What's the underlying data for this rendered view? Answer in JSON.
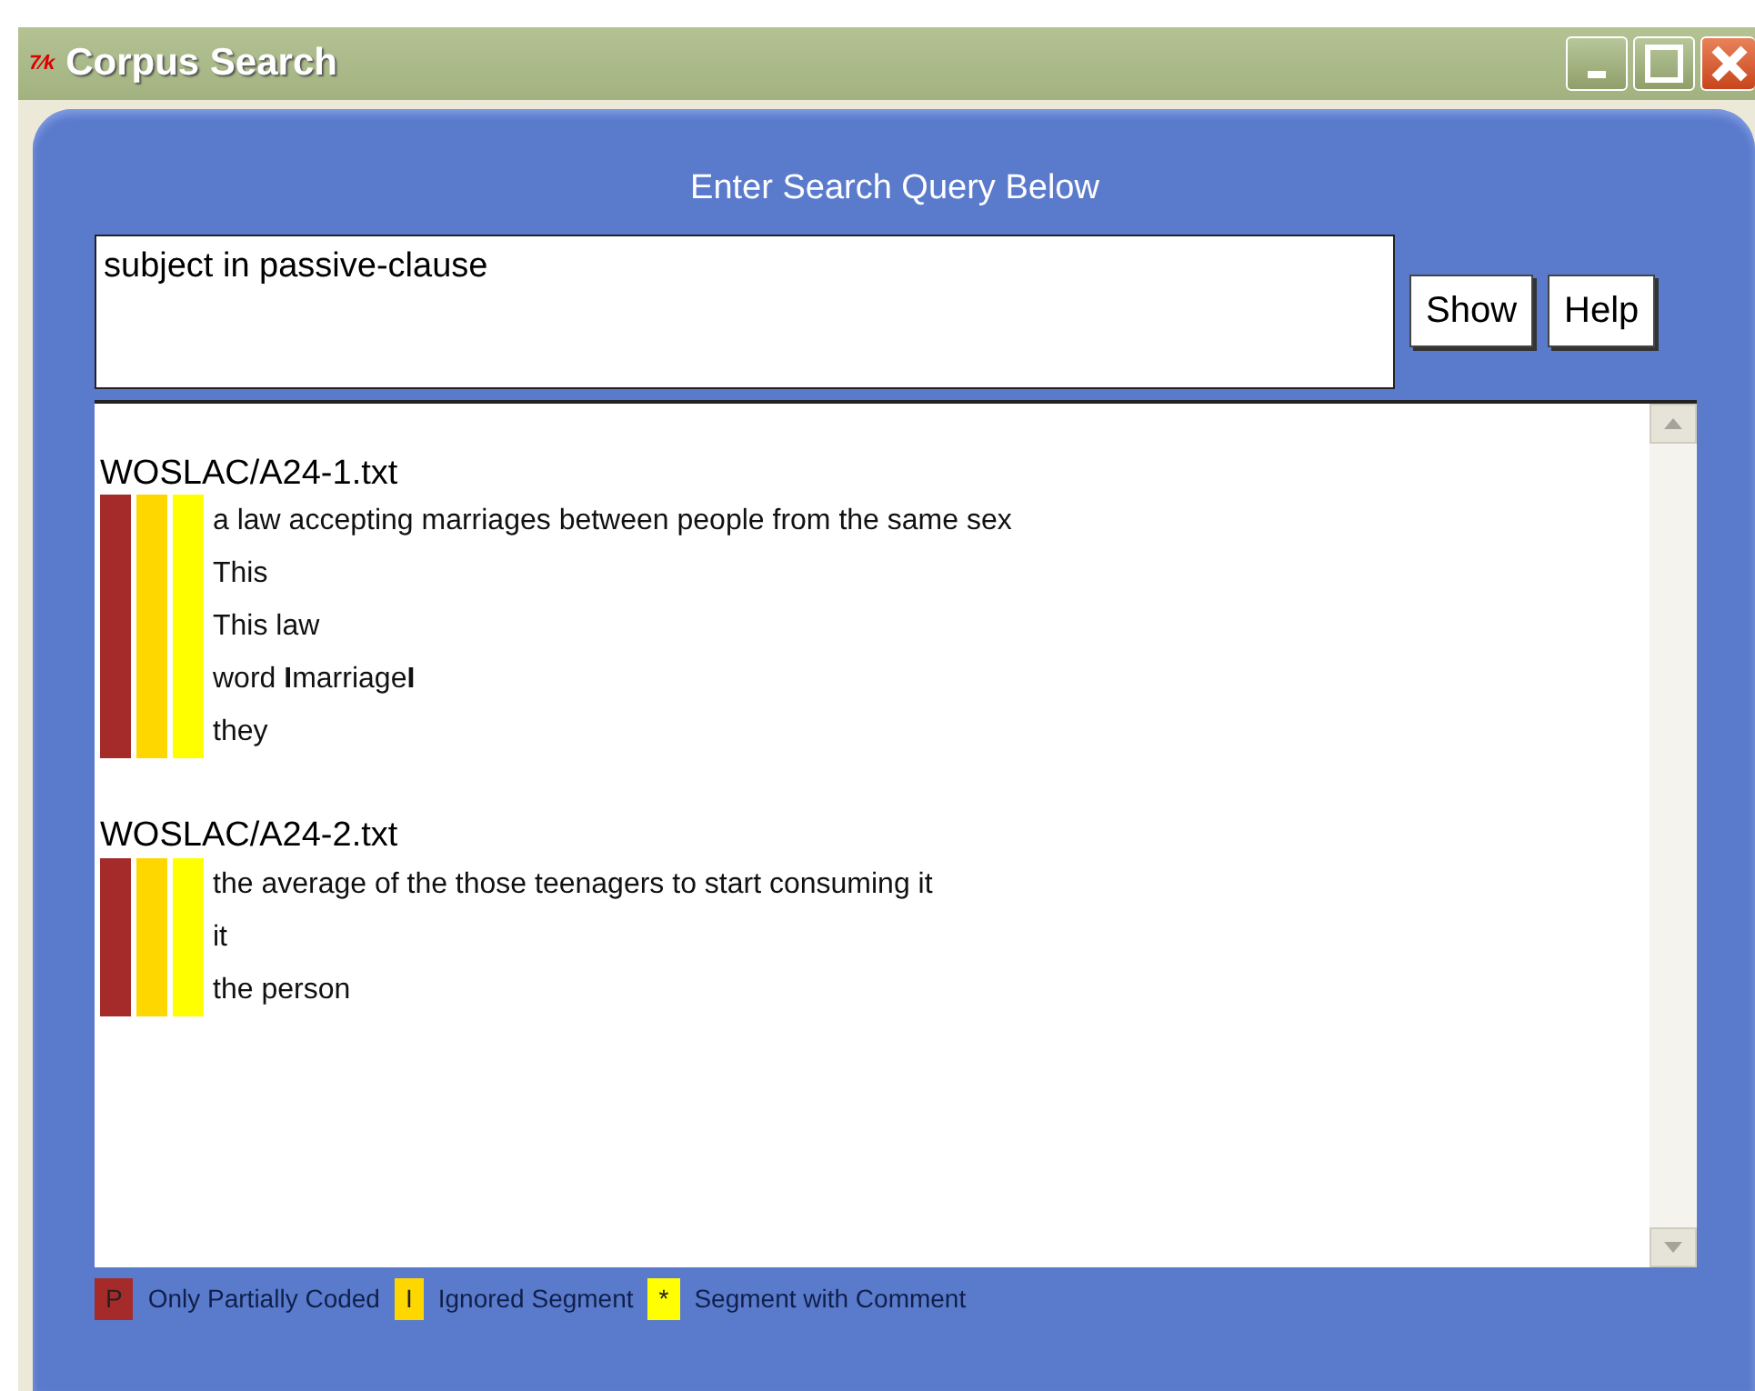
{
  "window": {
    "title": "Corpus Search",
    "app_icon": "7⁄k"
  },
  "prompt": "Enter Search Query Below",
  "query": {
    "value": "subject in passive-clause"
  },
  "buttons": [
    "Show",
    "Help"
  ],
  "results": [
    {
      "file": "WOSLAC/A24-1.txt",
      "markers": [
        {
          "color": "#a52a2a"
        },
        {
          "color": "#ffd700"
        },
        {
          "color": "#ffff00"
        }
      ],
      "lines": [
        "a law accepting marriages between people from the same sex",
        "This",
        "This law",
        "word **I**marriage**I**",
        "they"
      ]
    },
    {
      "file": "WOSLAC/A24-2.txt",
      "markers": [
        {
          "color": "#a52a2a"
        },
        {
          "color": "#ffd700"
        },
        {
          "color": "#ffff00"
        }
      ],
      "lines": [
        "the average of the those teenagers to start consuming it",
        "it",
        "the person"
      ]
    }
  ],
  "legend": [
    {
      "key": "P",
      "color": "#a52a2a",
      "label": "Only Partially Coded"
    },
    {
      "key": "I",
      "color": "#ffd700",
      "label": "Ignored Segment"
    },
    {
      "key": "*",
      "color": "#ffff00",
      "label": "Segment with Comment"
    }
  ]
}
